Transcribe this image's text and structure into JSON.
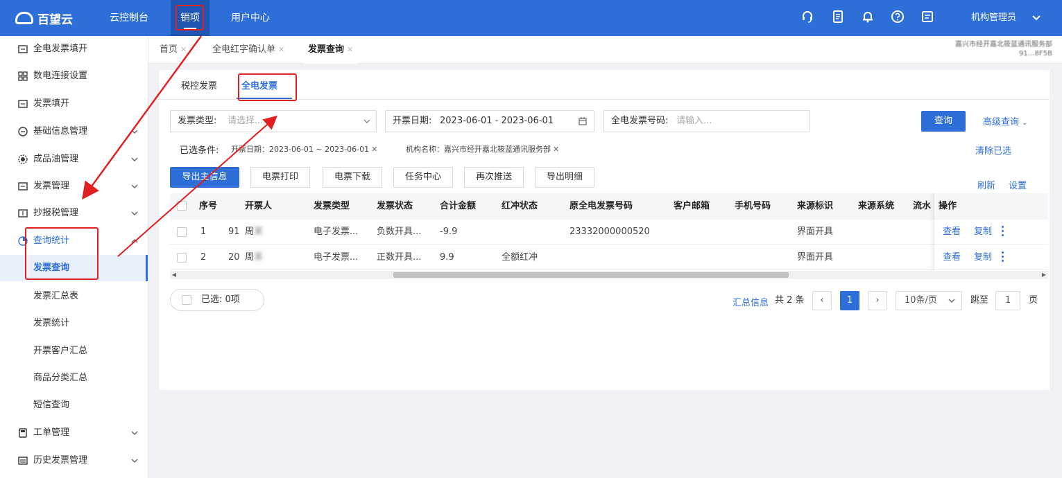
{
  "topbar": {
    "logo_text": "百望云",
    "nav": [
      "云控制台",
      "销项",
      "用户中心"
    ],
    "active_nav": "销项",
    "user_name": "机构管理员",
    "icons": [
      "headset-icon",
      "document-icon",
      "bell-icon",
      "help-icon",
      "notice-icon",
      "chevron-down-icon"
    ]
  },
  "sidebar": {
    "items": [
      {
        "label": "全电发票填开",
        "icon": "invoice-icon"
      },
      {
        "label": "数电连接设置",
        "icon": "grid-icon"
      },
      {
        "label": "发票填开",
        "icon": "invoice-icon"
      },
      {
        "label": "基础信息管理",
        "icon": "info-icon"
      },
      {
        "label": "成品油管理",
        "icon": "oil-icon"
      },
      {
        "label": "发票管理",
        "icon": "invoice-icon"
      },
      {
        "label": "抄报税管理",
        "icon": "tax-icon"
      },
      {
        "label": "查询统计",
        "icon": "chart-icon"
      },
      {
        "label": "发票查询",
        "icon": ""
      },
      {
        "label": "发票汇总表",
        "icon": ""
      },
      {
        "label": "发票统计",
        "icon": ""
      },
      {
        "label": "开票客户汇总",
        "icon": ""
      },
      {
        "label": "商品分类汇总",
        "icon": ""
      },
      {
        "label": "短信查询",
        "icon": ""
      },
      {
        "label": "工单管理",
        "icon": "ticket-icon"
      },
      {
        "label": "历史发票管理",
        "icon": "history-icon"
      }
    ]
  },
  "page_tabs": [
    {
      "label": "首页"
    },
    {
      "label": "全电红字确认单"
    },
    {
      "label": "发票查询"
    }
  ],
  "org_info": {
    "line1": "嘉兴市经开嘉北筱蓝通讯服务部",
    "line2": "91…8F5B"
  },
  "inner_tabs": [
    "税控发票",
    "全电发票"
  ],
  "filters": {
    "invoice_type_label": "发票类型:",
    "invoice_type_placeholder": "请选择...",
    "date_label": "开票日期:",
    "date_value": "2023-06-01 - 2023-06-01",
    "number_label": "全电发票号码:",
    "number_placeholder": "请输入...",
    "search_button": "查询",
    "advanced_link": "高级查询"
  },
  "conditions": {
    "label": "已选条件:",
    "chips": [
      "开票日期：2023-06-01 ~ 2023-06-01",
      "机构名称：嘉兴市经开嘉北筱蓝通讯服务部"
    ],
    "clear_link": "清除已选"
  },
  "actions": {
    "buttons": [
      "导出主信息",
      "电票打印",
      "电票下载",
      "任务中心",
      "再次推送",
      "导出明细"
    ],
    "refresh": "刷新",
    "settings": "设置"
  },
  "table": {
    "columns": [
      "序号",
      "开票人",
      "发票类型",
      "发票状态",
      "合计金额",
      "红冲状态",
      "原全电发票号码",
      "客户邮箱",
      "手机号码",
      "来源标识",
      "来源系统",
      "流水",
      "操作"
    ],
    "rows": [
      {
        "index": "1",
        "id_prefix": "91",
        "issuer": "周",
        "type": "电子发票...",
        "status": "负数开具...",
        "amount": "-9.9",
        "red_status": "",
        "orig_no": "23332000000520",
        "email": "",
        "phone": "",
        "source_tag": "界面开具",
        "source_sys": "",
        "view": "查看",
        "copy": "复制"
      },
      {
        "index": "2",
        "id_prefix": "20",
        "issuer": "周",
        "type": "电子发票...",
        "status": "正数开具...",
        "amount": "9.9",
        "red_status": "全额红冲",
        "orig_no": "",
        "email": "",
        "phone": "",
        "source_tag": "界面开具",
        "source_sys": "",
        "view": "查看",
        "copy": "复制"
      }
    ]
  },
  "footer": {
    "selected": "已选: 0项",
    "summary_link": "汇总信息",
    "total": "共 2 条",
    "current_page": "1",
    "page_size": "10条/页",
    "jump_label": "跳至",
    "jump_value": "1",
    "page_unit": "页"
  },
  "colors": {
    "primary": "#2d6ed8",
    "annotation": "#e02020"
  }
}
